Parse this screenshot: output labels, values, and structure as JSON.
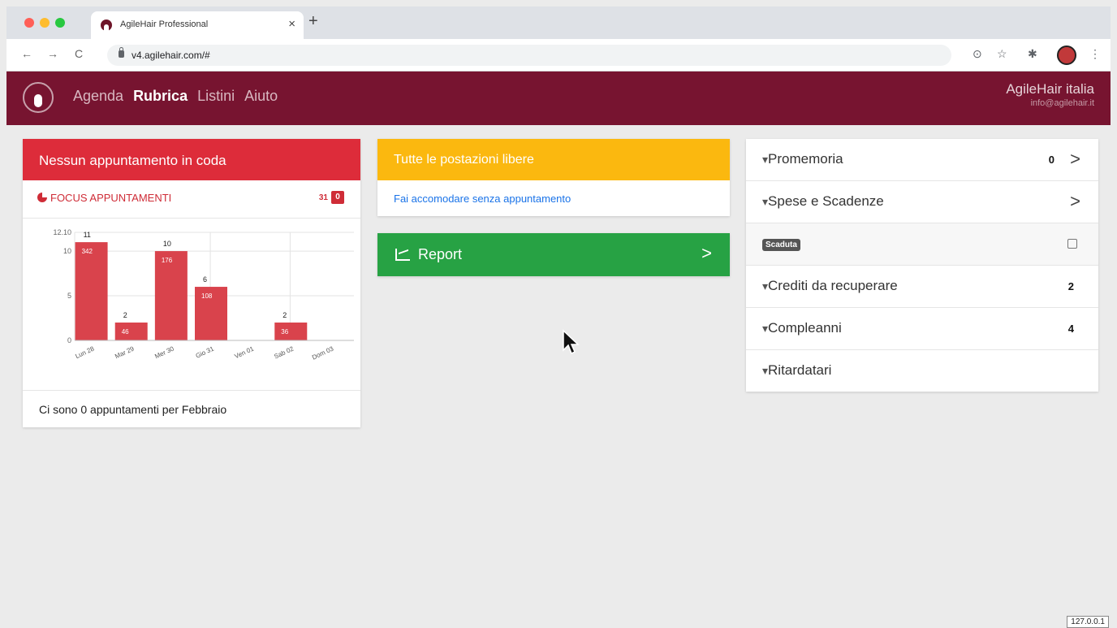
{
  "browser": {
    "tab_title": "AgileHair Professional",
    "tab_close": "×",
    "new_tab": "+",
    "url": "v4.agilehair.com/#",
    "nav": {
      "back": "←",
      "forward": "→",
      "reload": "C"
    },
    "right_icons": {
      "cast": "⊙",
      "bookmark": "☆",
      "extensions": "✱",
      "menu": "⋮"
    },
    "traffic_colors": [
      "#ff5f57",
      "#febc2e",
      "#28c840"
    ]
  },
  "header": {
    "nav": [
      "Agenda",
      "Rubrica",
      "Listini",
      "Aiuto"
    ],
    "active_nav": "Rubrica",
    "brand_name": "AgileHair italia",
    "brand_email": "info@agilehair.it",
    "color": "#771430"
  },
  "queue_card": {
    "title": "Nessun appuntamento in coda",
    "focus_label": "FOCUS APPUNTAMENTI",
    "focus_count": "31",
    "focus_badge": "0",
    "footer": "Ci sono 0 appuntamenti per Febbraio",
    "color": "#dd2c3a"
  },
  "stations_card": {
    "title": "Tutte le postazioni libere",
    "link": "Fai accomodare senza appuntamento",
    "color": "#fbb80f"
  },
  "report_card": {
    "label": "Report",
    "chevron": ">",
    "color": "#27a244"
  },
  "side_panel": {
    "rows": [
      {
        "label": "Promemoria",
        "count": "0",
        "chevron": ">"
      },
      {
        "label": "Spese e Scadenze",
        "chevron": ">"
      },
      {
        "badge": "Scaduta"
      },
      {
        "label": "Crediti da recuperare",
        "count": "2"
      },
      {
        "label": "Compleanni",
        "count": "4"
      },
      {
        "label": "Ritardatari"
      }
    ]
  },
  "chart_data": {
    "type": "bar",
    "categories": [
      "Lun 28",
      "Mar 29",
      "Mer 30",
      "Gio 31",
      "Ven 01",
      "Sab 02",
      "Dom 03"
    ],
    "values": [
      11,
      2,
      10,
      6,
      0,
      2,
      0
    ],
    "inner_labels": [
      "342",
      "46",
      "176",
      "108",
      "",
      "36",
      ""
    ],
    "top_labels": [
      "11",
      "2",
      "10",
      "6",
      "",
      "2",
      ""
    ],
    "yticks": [
      "0",
      "5",
      "10",
      "12.10"
    ],
    "ylim": [
      0,
      12.1
    ],
    "color": "#d9434c"
  },
  "footer": {
    "ip": "127.0.0.1"
  }
}
